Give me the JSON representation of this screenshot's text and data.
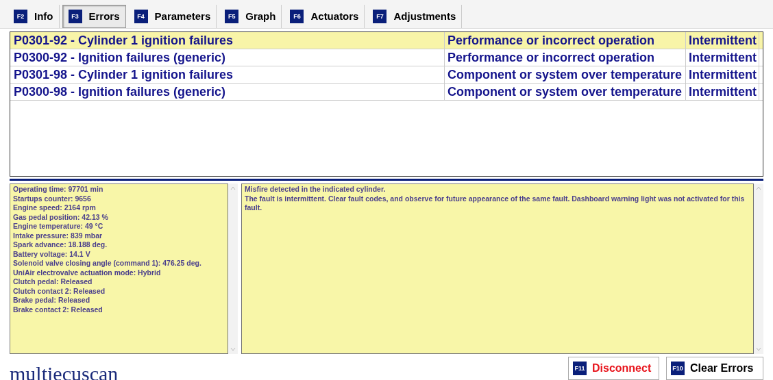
{
  "tabs": [
    {
      "key": "F2",
      "label": "Info",
      "selected": false
    },
    {
      "key": "F3",
      "label": "Errors",
      "selected": true
    },
    {
      "key": "F4",
      "label": "Parameters",
      "selected": false
    },
    {
      "key": "F5",
      "label": "Graph",
      "selected": false
    },
    {
      "key": "F6",
      "label": "Actuators",
      "selected": false
    },
    {
      "key": "F7",
      "label": "Adjustments",
      "selected": false
    }
  ],
  "errors": [
    {
      "code": "P0301-92 - Cylinder 1 ignition failures",
      "type": "Performance or incorrect operation",
      "status": "Intermittent",
      "selected": true
    },
    {
      "code": "P0300-92 - Ignition failures (generic)",
      "type": "Performance or incorrect operation",
      "status": "Intermittent",
      "selected": false
    },
    {
      "code": "P0301-98 - Cylinder 1 ignition failures",
      "type": "Component or system over temperature",
      "status": "Intermittent",
      "selected": false
    },
    {
      "code": "P0300-98 - Ignition failures (generic)",
      "type": "Component or system over temperature",
      "status": "Intermittent",
      "selected": false
    }
  ],
  "freeze_frame": [
    "Operating time: 97701 min",
    "Startups counter: 9656",
    "Engine speed: 2164 rpm",
    "Gas pedal position: 42.13 %",
    "Engine temperature: 49 °C",
    "Intake pressure: 839 mbar",
    "Spark advance: 18.188 deg.",
    "Battery voltage: 14.1 V",
    "Solenoid valve closing angle (command 1): 476.25 deg.",
    "UniAir electrovalve actuation mode: Hybrid",
    "Clutch pedal: Released",
    "Clutch contact 2: Released",
    "Brake pedal: Released",
    "Brake contact 2: Released"
  ],
  "description": [
    "Misfire detected in the indicated cylinder.",
    "The fault is intermittent. Clear fault codes, and observe for future appearance of the same fault. Dashboard warning light was not activated for this fault."
  ],
  "logo": "multiecuscan",
  "buttons": [
    {
      "key": "F11",
      "label": "Disconnect",
      "kind": "danger"
    },
    {
      "key": "F10",
      "label": "Clear Errors",
      "kind": "normal"
    }
  ]
}
